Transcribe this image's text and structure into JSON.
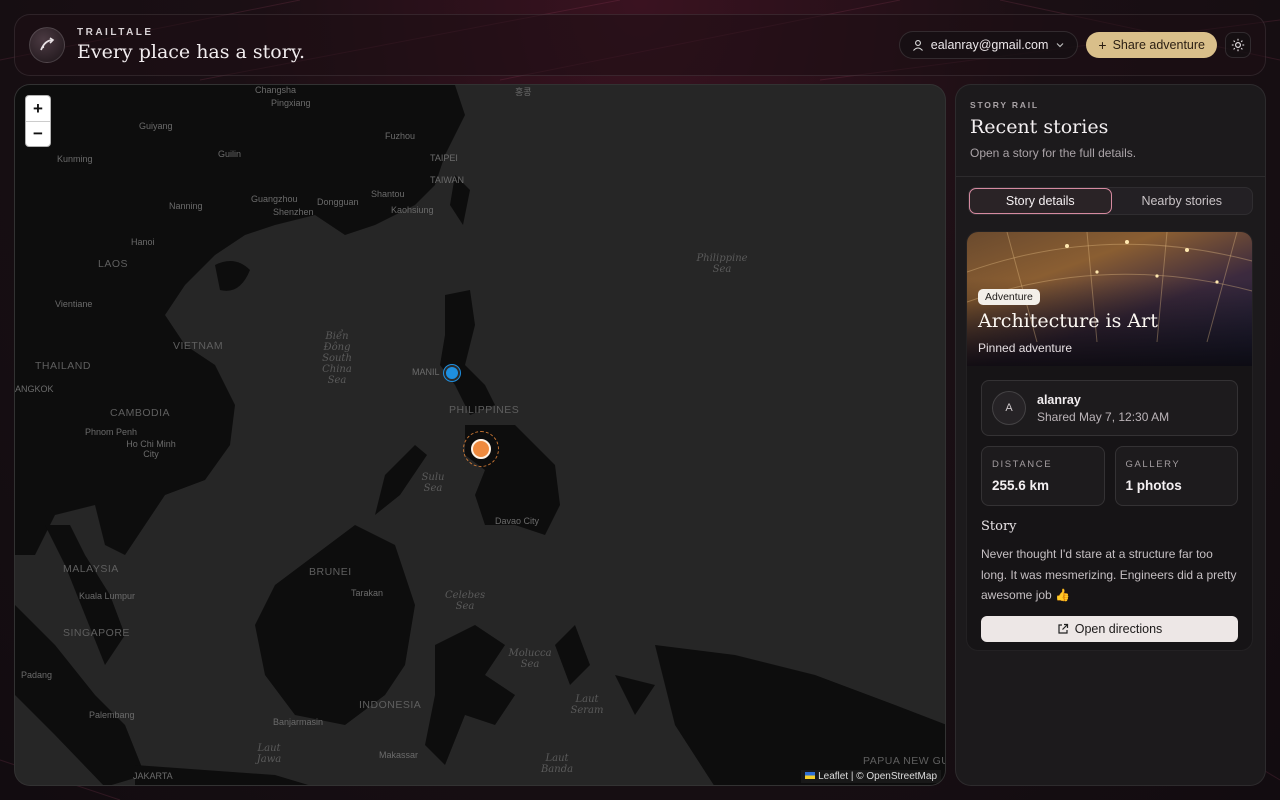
{
  "header": {
    "brand_name": "TRAILTALE",
    "tagline": "Every place has a story.",
    "account_email": "ealanray@gmail.com",
    "share_label": "Share adventure"
  },
  "map": {
    "zoom_in": "+",
    "zoom_out": "−",
    "attribution": "Leaflet | © OpenStreetMap",
    "labels": {
      "changsha": "Changsha",
      "pingxiang": "Pingxiang",
      "guiyang": "Guiyang",
      "fuzhou": "Fuzhou",
      "kunming": "Kunming",
      "guilin": "Guilin",
      "taipei": "TAIPEI",
      "taiwan": "TAIWAN",
      "nanning": "Nanning",
      "guangzhou": "Guangzhou",
      "dongguan": "Dongguan",
      "shenzhen": "Shenzhen",
      "shantou": "Shantou",
      "kaohsiung": "Kaohsiung",
      "hanoi": "Hanoi",
      "laos": "LAOS",
      "vientiane": "Vientiane",
      "vietnam": "VIETNAM",
      "thailand": "THAILAND",
      "bangkok": "ANGKOK",
      "cambodia": "CAMBODIA",
      "phnom_penh": "Phnom Penh",
      "ho_chi_minh": "Ho Chi Minh City",
      "philippine_sea": "Philippine Sea",
      "bien_dong": "Biển Đông South China Sea",
      "manila": "MANIL",
      "philippines": "PHILIPPINES",
      "sulu_sea": "Sulu Sea",
      "davao": "Davao City",
      "malaysia": "MALAYSIA",
      "kuala_lumpur": "Kuala Lumpur",
      "brunei": "BRUNEI",
      "tarakan": "Tarakan",
      "celebes_sea": "Celebes Sea",
      "singapore": "SINGAPORE",
      "padang": "Padang",
      "molucca_sea": "Molucca Sea",
      "palembang": "Palembang",
      "banjarmasin": "Banjarmasin",
      "indonesia": "INDONESIA",
      "laut_seram": "Laut Seram",
      "laut_jawa": "Laut Jawa",
      "makassar": "Makassar",
      "laut_banda": "Laut Banda",
      "jakarta": "JAKARTA",
      "papua": "PAPUA NEW GUINEA",
      "top_label": "홍콩"
    }
  },
  "rail": {
    "eyebrow": "STORY RAIL",
    "title": "Recent stories",
    "subtitle": "Open a story for the full details.",
    "tabs": [
      "Story details",
      "Nearby stories"
    ],
    "story": {
      "category": "Adventure",
      "title": "Architecture is Art",
      "subtitle": "Pinned adventure",
      "author_initial": "A",
      "author_name": "alanray",
      "shared": "Shared May 7, 12:30 AM",
      "distance_label": "DISTANCE",
      "distance_value": "255.6 km",
      "gallery_label": "GALLERY",
      "gallery_value": "1 photos",
      "story_heading": "Story",
      "story_text": "Never thought I'd stare at a structure far too long. It was mesmerizing. Engineers did a pretty awesome job 👍",
      "directions_label": "Open directions"
    }
  },
  "colors": {
    "accent": "#d9bf8a",
    "tab_outline": "#d58aa0",
    "marker_current": "#1e8fe0",
    "marker_story": "#ef8a3e"
  }
}
